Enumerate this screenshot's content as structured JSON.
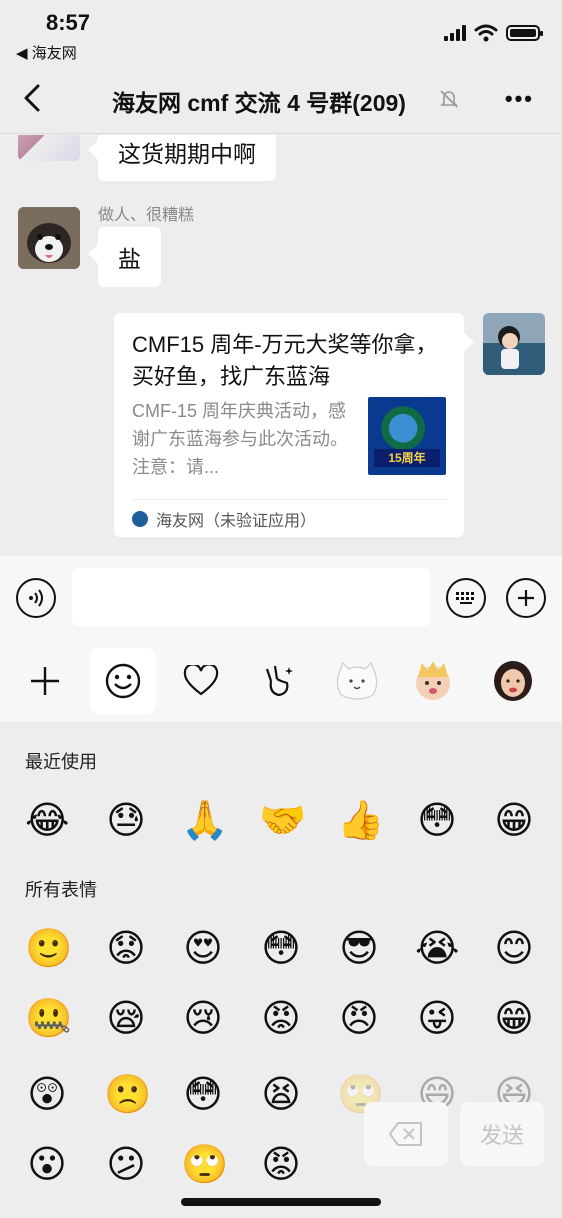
{
  "status_bar": {
    "time": "8:57",
    "back_app": "◀ 海友网"
  },
  "nav": {
    "title": "海友网 cmf 交流 4 号群(209)",
    "more": "•••"
  },
  "messages": [
    {
      "text": "这货期期中啊"
    },
    {
      "sender": "做人、很糟糕",
      "text": "盐"
    }
  ],
  "card": {
    "title": "CMF15 周年-万元大奖等你拿，买好鱼，找广东蓝海",
    "description": "CMF-15 周年庆典活动，感谢广东蓝海参与此次活动。注意：请...",
    "thumb_text": "15周年",
    "source": "海友网（未验证应用）"
  },
  "input": {
    "placeholder": ""
  },
  "emoji_panel": {
    "recent_title": "最近使用",
    "all_title": "所有表情",
    "recent": [
      "😂",
      "😓",
      "🙏",
      "🤝",
      "👍",
      "😳",
      "😁"
    ],
    "all_row1": [
      "🙂",
      "😟",
      "😍",
      "😳",
      "😎",
      "😭",
      "😊"
    ],
    "all_row2": [
      "🤐",
      "😪",
      "😢",
      "😡",
      "😠",
      "😜",
      "😁"
    ],
    "all_row3": [
      "😲",
      "🙁",
      "😳",
      "😫",
      "🙄",
      "😄",
      "😆"
    ],
    "all_row4": [
      "😮",
      "😕",
      "🙄",
      "😡"
    ],
    "delete_icon": "backspace-icon",
    "send_label": "发送"
  },
  "colors": {
    "background": "#ededed",
    "bubble": "#ffffff",
    "panel": "#f7f7f7"
  }
}
